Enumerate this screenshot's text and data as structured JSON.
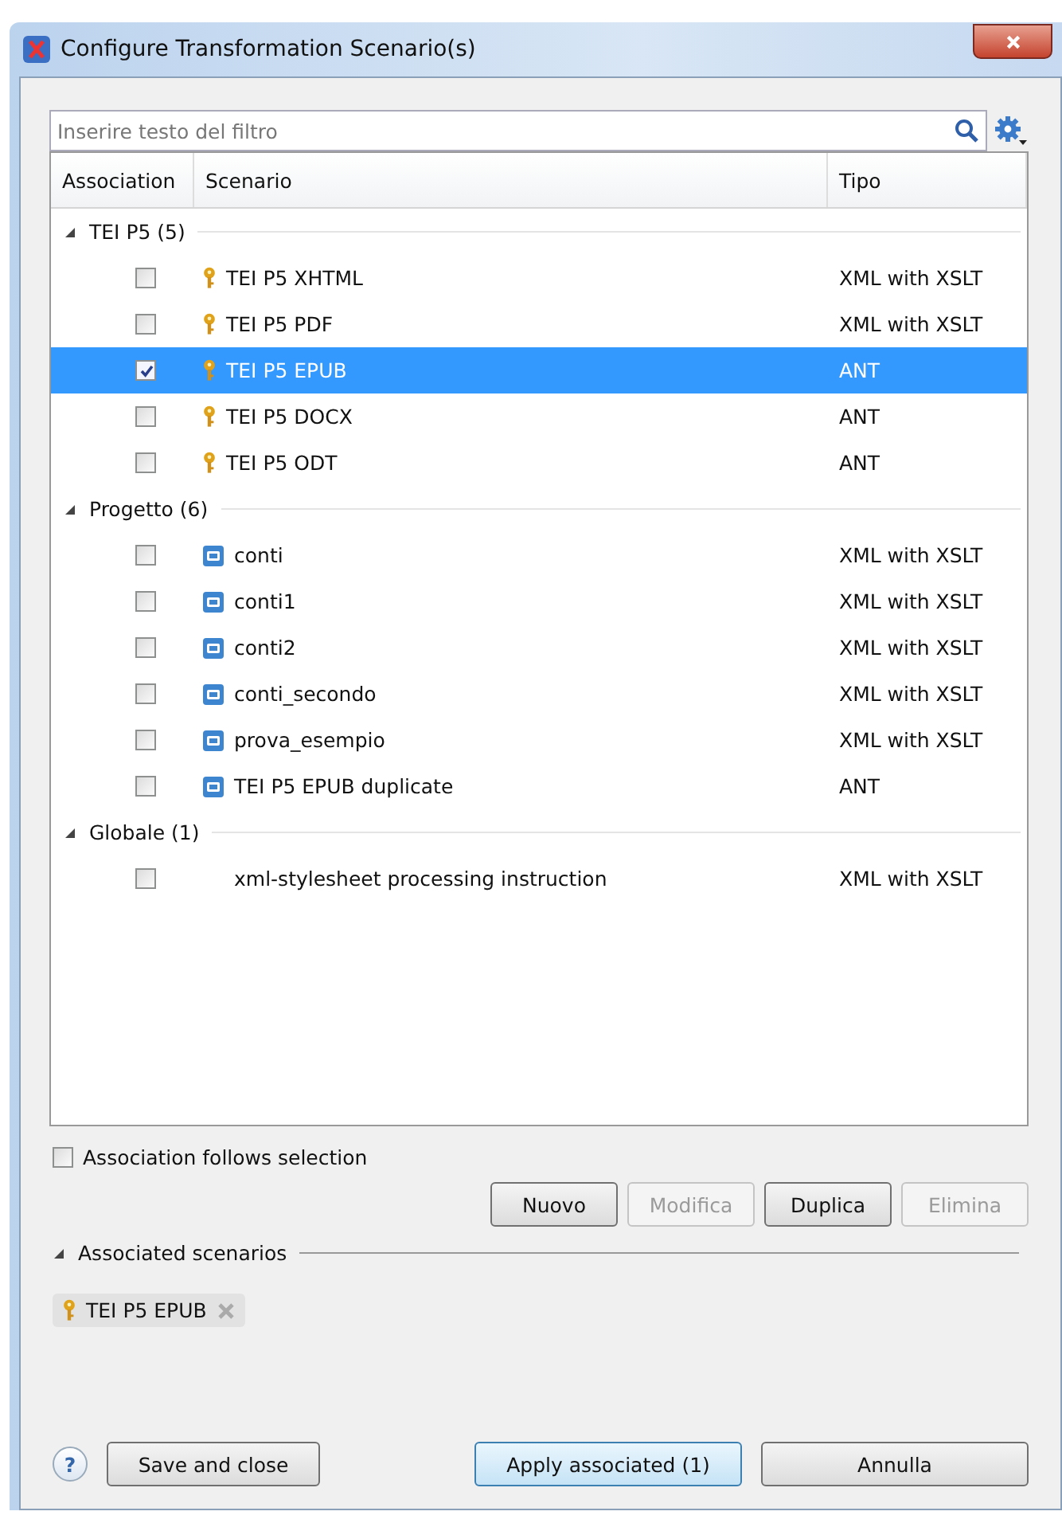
{
  "window": {
    "title": "Configure Transformation Scenario(s)"
  },
  "filter": {
    "placeholder": "Inserire testo del filtro"
  },
  "table": {
    "columns": [
      "Association",
      "Scenario",
      "Tipo"
    ],
    "groups": [
      {
        "label": "TEI P5 (5)",
        "expanded": true,
        "rows": [
          {
            "kind": "key",
            "scenario": "TEI P5 XHTML",
            "tipo": "XML with XSLT",
            "checked": false,
            "selected": false
          },
          {
            "kind": "key",
            "scenario": "TEI P5 PDF",
            "tipo": "XML with XSLT",
            "checked": false,
            "selected": false
          },
          {
            "kind": "key",
            "scenario": "TEI P5 EPUB",
            "tipo": "ANT",
            "checked": true,
            "selected": true
          },
          {
            "kind": "key",
            "scenario": "TEI P5 DOCX",
            "tipo": "ANT",
            "checked": false,
            "selected": false
          },
          {
            "kind": "key",
            "scenario": "TEI P5 ODT",
            "tipo": "ANT",
            "checked": false,
            "selected": false
          }
        ]
      },
      {
        "label": "Progetto (6)",
        "expanded": true,
        "rows": [
          {
            "kind": "project",
            "scenario": "conti",
            "tipo": "XML with XSLT",
            "checked": false,
            "selected": false
          },
          {
            "kind": "project",
            "scenario": "conti1",
            "tipo": "XML with XSLT",
            "checked": false,
            "selected": false
          },
          {
            "kind": "project",
            "scenario": "conti2",
            "tipo": "XML with XSLT",
            "checked": false,
            "selected": false
          },
          {
            "kind": "project",
            "scenario": "conti_secondo",
            "tipo": "XML with XSLT",
            "checked": false,
            "selected": false
          },
          {
            "kind": "project",
            "scenario": "prova_esempio",
            "tipo": "XML with XSLT",
            "checked": false,
            "selected": false
          },
          {
            "kind": "project",
            "scenario": "TEI P5 EPUB duplicate",
            "tipo": "ANT",
            "checked": false,
            "selected": false
          }
        ]
      },
      {
        "label": "Globale (1)",
        "expanded": true,
        "rows": [
          {
            "kind": "plain",
            "scenario": "xml-stylesheet processing instruction",
            "tipo": "XML with XSLT",
            "checked": false,
            "selected": false
          }
        ]
      }
    ]
  },
  "follow_selection": {
    "label": "Association follows selection",
    "checked": false
  },
  "actions": [
    {
      "label": "Nuovo",
      "disabled": false
    },
    {
      "label": "Modifica",
      "disabled": true
    },
    {
      "label": "Duplica",
      "disabled": false
    },
    {
      "label": "Elimina",
      "disabled": true
    }
  ],
  "associated": {
    "title": "Associated scenarios",
    "expanded": true,
    "items": [
      {
        "kind": "key",
        "label": "TEI P5 EPUB"
      }
    ]
  },
  "footer": {
    "help": "?",
    "buttons": [
      {
        "label": "Save and close",
        "default": false
      },
      {
        "label": "Apply associated (1)",
        "default": true
      },
      {
        "label": "Annulla",
        "default": false
      }
    ]
  }
}
